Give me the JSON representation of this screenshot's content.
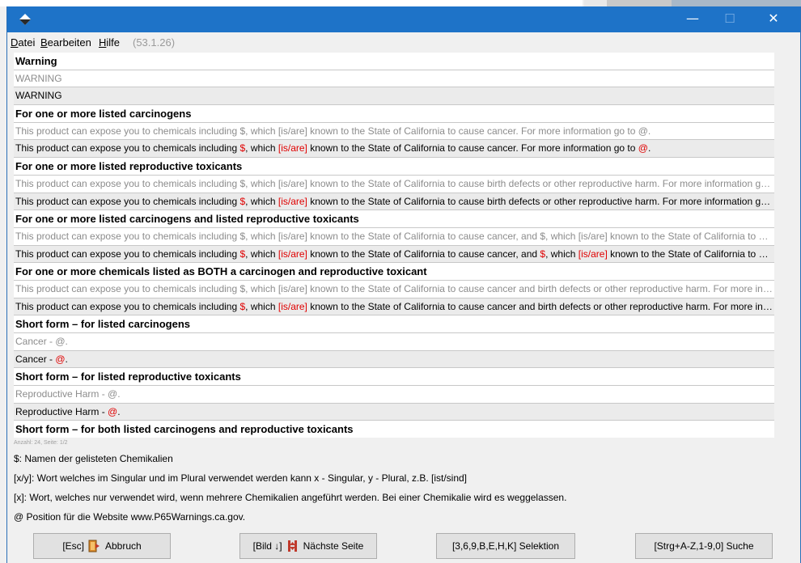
{
  "window": {
    "controls": {
      "minimize": "—",
      "maximize": "☐",
      "close": "✕"
    }
  },
  "menu": {
    "datei": "Datei",
    "bearbeiten": "Bearbeiten",
    "hilfe": "Hilfe",
    "version": "(53.1.26)"
  },
  "rows": [
    {
      "type": "head",
      "text": "Warning"
    },
    {
      "type": "grey",
      "text": "WARNING"
    },
    {
      "type": "edit",
      "text": "WARNING"
    },
    {
      "type": "head",
      "text": "For one or more listed carcinogens"
    },
    {
      "type": "grey",
      "text": "This product can expose you to chemicals including $, which [is/are] known to the State of California to cause cancer. For more information go to @."
    },
    {
      "type": "edit",
      "parts": [
        "This product can expose you to chemicals including ",
        "$",
        ", which ",
        "[is/are]",
        " known to the State of California to cause cancer. For more information go to ",
        "@",
        "."
      ]
    },
    {
      "type": "head",
      "text": "For one or more listed reproductive toxicants"
    },
    {
      "type": "grey",
      "text": "This product can expose you to chemicals including $, which [is/are] known to the State of California to cause birth defects or other reproductive harm. For more information go to @."
    },
    {
      "type": "edit",
      "parts": [
        "This product can expose you to chemicals including ",
        "$",
        ", which ",
        "[is/are]",
        " known to the State of California to cause birth defects or other reproductive harm. For more information go to ",
        "@",
        "."
      ]
    },
    {
      "type": "head",
      "text": "For one or more listed carcinogens and listed reproductive toxicants"
    },
    {
      "type": "grey",
      "text": "This product can expose you to chemicals including $, which [is/are] known to the State of California to cause cancer, and $, which [is/are] known to the State of California to cause birth defects."
    },
    {
      "type": "edit",
      "parts": [
        "This product can expose you to chemicals including ",
        "$",
        ", which ",
        "[is/are]",
        " known to the State of California to cause cancer, and ",
        "$",
        ", which ",
        "[is/are]",
        " known to the State of California to cause birth defects."
      ]
    },
    {
      "type": "head",
      "text": "For one or more chemicals listed as BOTH a carcinogen and reproductive toxicant"
    },
    {
      "type": "grey",
      "text": "This product can expose you to chemicals including $, which [is/are] known to the State of California to cause cancer and birth defects or other reproductive harm. For more information go to @."
    },
    {
      "type": "edit",
      "parts": [
        "This product can expose you to chemicals including ",
        "$",
        ", which ",
        "[is/are]",
        " known to the State of California to cause cancer and birth defects or other reproductive harm. For more information go to ",
        "@",
        "."
      ]
    },
    {
      "type": "head",
      "text": "Short form – for listed carcinogens"
    },
    {
      "type": "grey",
      "text": "Cancer - @."
    },
    {
      "type": "edit",
      "parts": [
        "Cancer - ",
        "@",
        "."
      ]
    },
    {
      "type": "head",
      "text": "Short form – for listed reproductive toxicants"
    },
    {
      "type": "grey",
      "text": "Reproductive Harm - @."
    },
    {
      "type": "edit",
      "parts": [
        "Reproductive Harm - ",
        "@",
        "."
      ]
    },
    {
      "type": "head",
      "text": "Short form – for both listed carcinogens and reproductive toxicants"
    }
  ],
  "count": "Anzahl: 24, Seite: 1/2",
  "legend": {
    "l1": "$: Namen der gelisteten Chemikalien",
    "l2": "[x/y]: Wort welches im Singular und im Plural verwendet werden kann x - Singular, y - Plural, z.B. [ist/sind]",
    "l3": "[x]: Wort, welches nur verwendet wird, wenn mehrere Chemikalien angeführt werden. Bei einer Chemikalie wird es weggelassen.",
    "l4": "@ Position für die Website www.P65Warnings.ca.gov."
  },
  "buttons": {
    "esc_key": "[Esc]",
    "esc_label": "Abbruch",
    "next_key": "[Bild ↓]",
    "next_label": "Nächste Seite",
    "sel_label": "[3,6,9,B,E,H,K] Selektion",
    "search_label": "[Strg+A-Z,1-9,0] Suche"
  },
  "colors": {
    "titlebar": "#1e73c8",
    "placeholder_red": "#e00000"
  }
}
